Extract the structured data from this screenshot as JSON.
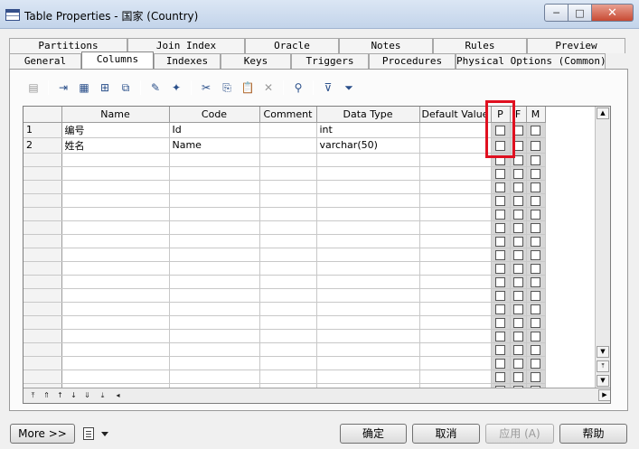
{
  "window": {
    "title": "Table Properties - 国家 (Country)",
    "minimize_glyph": "─",
    "maximize_glyph": "□",
    "close_glyph": "✕"
  },
  "tabs": {
    "back_row": [
      "Partitions",
      "Join Index",
      "Oracle",
      "Notes",
      "Rules",
      "Preview"
    ],
    "front_row": [
      "General",
      "Columns",
      "Indexes",
      "Keys",
      "Triggers",
      "Procedures",
      "Physical Options (Common)"
    ],
    "active": "Columns"
  },
  "toolbar": {
    "icons": [
      "properties-icon",
      "insert-row-icon",
      "add-row-icon",
      "add-columns-icon",
      "reuse-columns-icon",
      "new-domain-icon",
      "wizard-icon",
      "cut-icon",
      "copy-icon",
      "paste-icon",
      "delete-icon",
      "find-icon",
      "filter-icon",
      "clear-filter-icon"
    ]
  },
  "grid": {
    "headers": [
      "Name",
      "Code",
      "Comment",
      "Data Type",
      "Default Value",
      "P",
      "F",
      "M"
    ],
    "rows": [
      {
        "num": "1",
        "name": "编号",
        "code": "Id",
        "comment": "",
        "datatype": "int",
        "default": "",
        "p": false,
        "f": false,
        "m": false
      },
      {
        "num": "2",
        "name": "姓名",
        "code": "Name",
        "comment": "",
        "datatype": "varchar(50)",
        "default": "",
        "p": false,
        "f": false,
        "m": false
      }
    ],
    "empty_row_count": 19
  },
  "buttons": {
    "more": "More >>",
    "ok": "确定",
    "cancel": "取消",
    "apply": "应用 (A)",
    "help": "帮助"
  },
  "colors": {
    "highlight": "#e01020",
    "titlebar": "#c3d4ea"
  }
}
